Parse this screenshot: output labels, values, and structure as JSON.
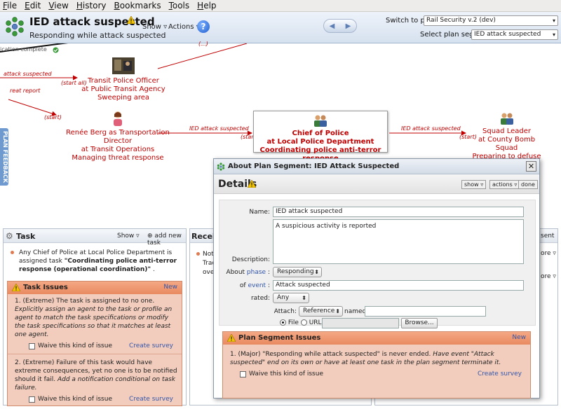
{
  "menu": [
    "File",
    "Edit",
    "View",
    "History",
    "Bookmarks",
    "Tools",
    "Help"
  ],
  "header": {
    "title": "IED attack suspected",
    "subtitle": "Responding while attack suspected",
    "show_label": "Show",
    "actions_label": "Actions",
    "help_label": "?",
    "switch_plan_label": "Switch to plan:",
    "switch_plan_value": "Rail Security v.2 (dev)",
    "select_segment_label": "Select plan segment:",
    "select_segment_value": "IED attack suspected"
  },
  "canvas": {
    "feedback_tab": "PLAN FEEDBACK",
    "top_note": "ication complete",
    "nodes": {
      "transit_officer": [
        "Transit Police Officer",
        "at Public Transit Agency",
        "Sweeping area"
      ],
      "renee": [
        "Renée Berg as Transportation Director",
        "at Transit Operations",
        "Managing threat response"
      ],
      "chief": [
        "Chief of Police",
        "at Local Police Department",
        "Coordinating police anti-terror response"
      ],
      "squad": [
        "Squad Leader",
        "at County Bomb Squad",
        "Preparing to defuse bomb"
      ]
    },
    "edges": {
      "attack_suspected_left": "attack suspected",
      "start_all": "(start all)",
      "threat_report": "reat report",
      "start1": "(start)",
      "ied_1": "IED attack suspected",
      "start2": "(start)",
      "ied_2": "IED attack suspected",
      "start3": "(start)",
      "top_mid": "(...)"
    }
  },
  "task_panel": {
    "title": "Task",
    "show_label": "Show",
    "add_task_label": "add new task",
    "assignment_prefix": "Any Chief of Police at Local Police Department is assigned task ",
    "assignment_task": "\"Coordinating police anti-terror response (operational coordination)\"",
    "assignment_suffix": " .",
    "issues_title": "Task Issues",
    "new_label": "New",
    "issues": [
      {
        "num": "1.",
        "severity": "(Extreme) The task is assigned to no one. ",
        "remedy": "Explicitly assign an agent to the task or profile an agent to match the task specifications or modify the task specifications so that it matches at least one agent.",
        "waive": "Waive this kind of issue",
        "survey": "Create survey"
      },
      {
        "num": "2.",
        "severity": "(Extreme) Failure of this task would have extreme consequences, yet no one is to be notified should it fail. ",
        "remedy": "Add a notification conditional on task failure.",
        "waive": "Waive this kind of issue",
        "survey": "Create survey"
      }
    ]
  },
  "recv_panel": {
    "title": "Receiv",
    "lines": [
      "Not",
      "Trac",
      "ove"
    ]
  },
  "right_strip": {
    "sent": "sent",
    "more1": "ore",
    "more2": "ore"
  },
  "dialog": {
    "title": "About Plan Segment: IED Attack Suspected",
    "close": "✕",
    "details": "Details",
    "show_btn": "show",
    "actions_btn": "actions",
    "done_btn": "done",
    "name_label": "Name:",
    "name_value": "IED attack suspected",
    "description_label": "Description:",
    "description_value": "A suspicious activity is reported",
    "about_label": "About",
    "phase_link": "phase",
    "phase_value": "Responding",
    "of_label": "of",
    "event_link": "event",
    "event_value": "Attack suspected",
    "rated_label": "rated:",
    "rated_value": "Any",
    "attach_label": "Attach:",
    "attach_value": "Reference",
    "named_label": "named",
    "file_label": "File",
    "url_label": "URL",
    "browse_label": "Browse...",
    "issues_title": "Plan Segment Issues",
    "new_label": "New",
    "issue_num": "1.",
    "issue_text": "(Major) \"Responding while attack suspected\" is never ended. ",
    "issue_remedy": "Have event \"Attack suspected\" end on its own or have at least one task in the plan segment terminate it.",
    "waive": "Waive this kind of issue",
    "survey": "Create survey"
  }
}
